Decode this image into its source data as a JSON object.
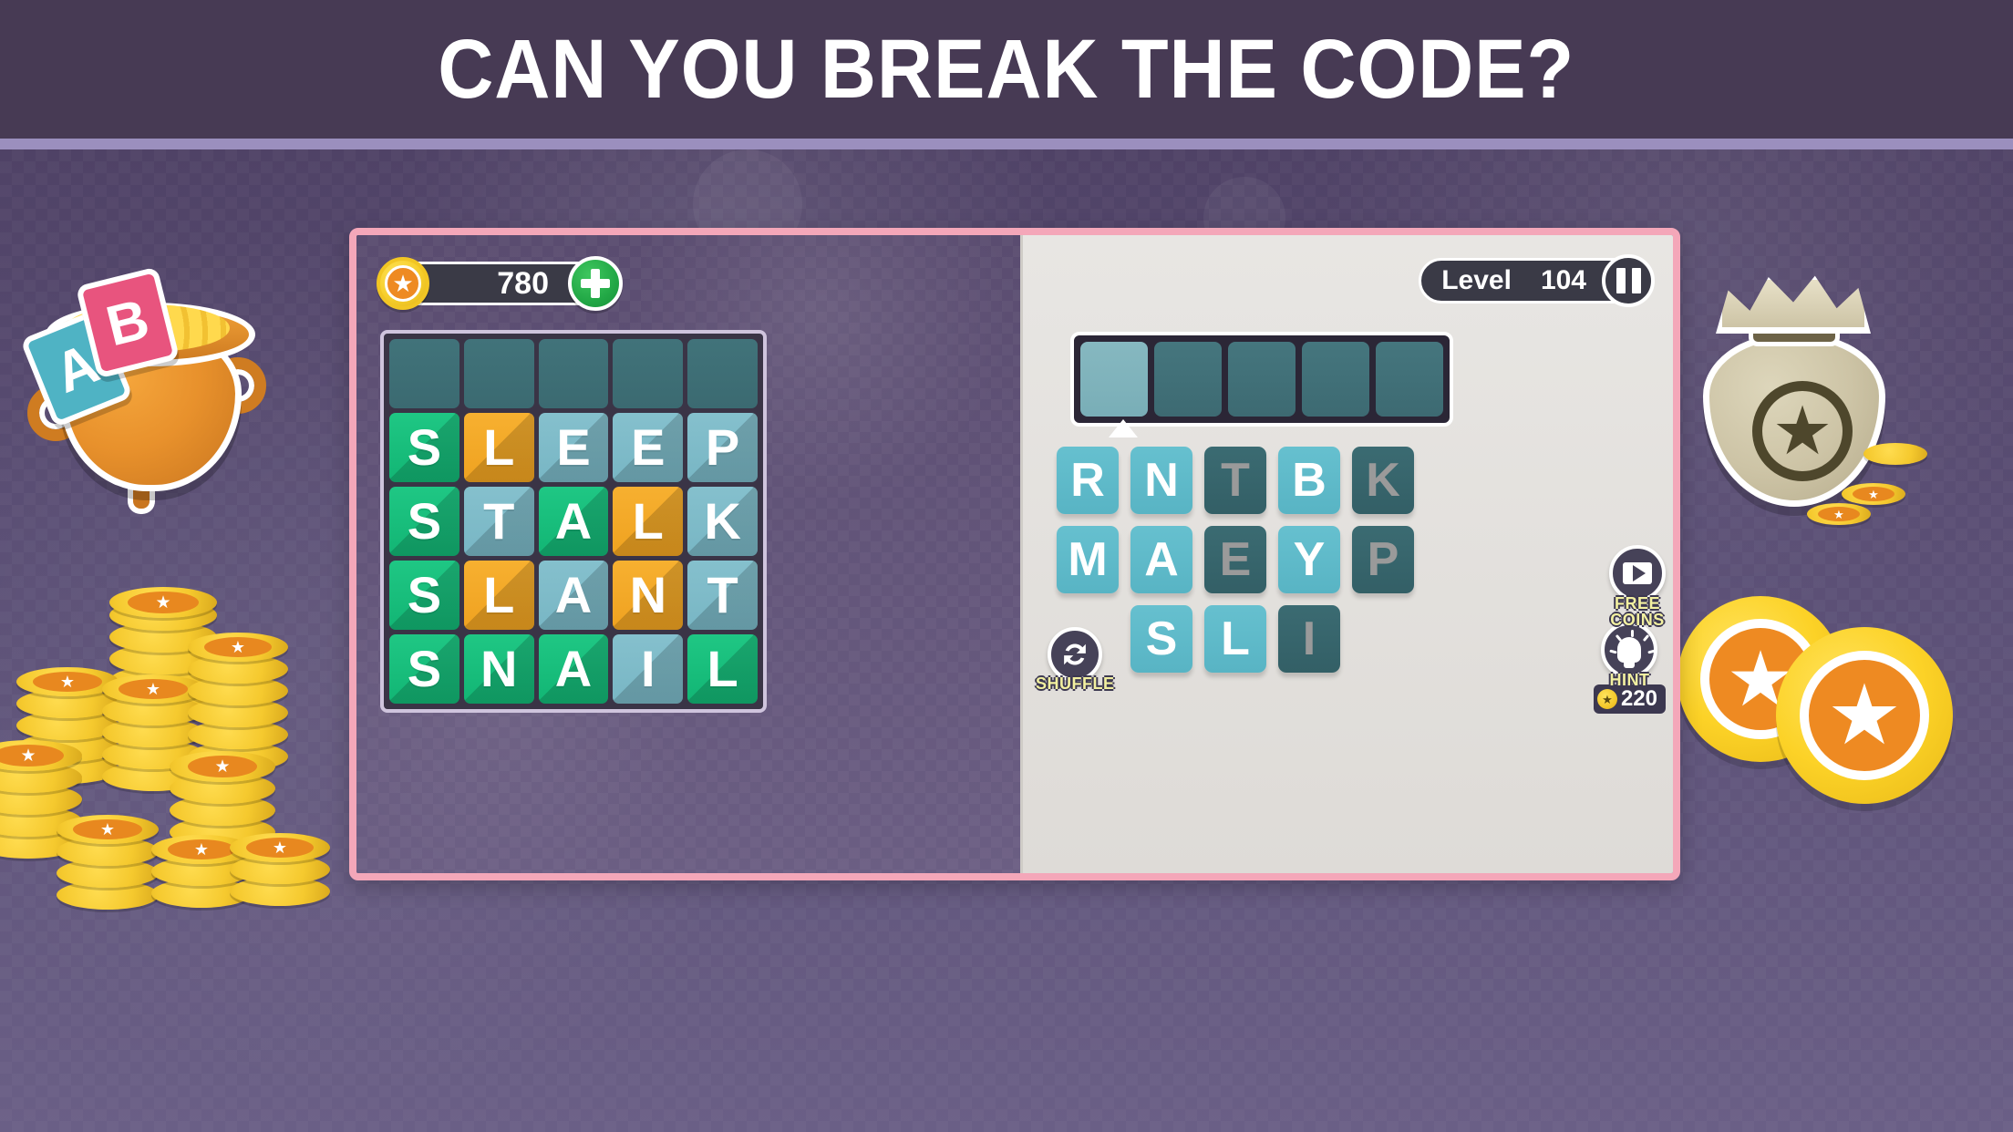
{
  "banner": {
    "title": "CAN YOU BREAK THE CODE?"
  },
  "hud": {
    "coins": "780",
    "coin_icon": "star-coin-icon",
    "add_label": "+",
    "level_label": "Level",
    "level_value": "104",
    "pause_icon": "pause-icon"
  },
  "word_grid": {
    "rows": [
      {
        "cells": [
          {
            "letter": "",
            "color": "empty"
          },
          {
            "letter": "",
            "color": "empty"
          },
          {
            "letter": "",
            "color": "empty"
          },
          {
            "letter": "",
            "color": "empty"
          },
          {
            "letter": "",
            "color": "empty"
          }
        ]
      },
      {
        "word": "SLEEP",
        "cells": [
          {
            "letter": "S",
            "color": "c-green"
          },
          {
            "letter": "L",
            "color": "c-orange"
          },
          {
            "letter": "E",
            "color": "c-blue"
          },
          {
            "letter": "E",
            "color": "c-blue"
          },
          {
            "letter": "P",
            "color": "c-blue"
          }
        ]
      },
      {
        "word": "STALK",
        "cells": [
          {
            "letter": "S",
            "color": "c-green"
          },
          {
            "letter": "T",
            "color": "c-blue"
          },
          {
            "letter": "A",
            "color": "c-green"
          },
          {
            "letter": "L",
            "color": "c-orange"
          },
          {
            "letter": "K",
            "color": "c-blue"
          }
        ]
      },
      {
        "word": "SLANT",
        "cells": [
          {
            "letter": "S",
            "color": "c-green"
          },
          {
            "letter": "L",
            "color": "c-orange"
          },
          {
            "letter": "A",
            "color": "c-blue"
          },
          {
            "letter": "N",
            "color": "c-orange"
          },
          {
            "letter": "T",
            "color": "c-blue"
          }
        ]
      },
      {
        "word": "SNAIL",
        "cells": [
          {
            "letter": "S",
            "color": "c-green"
          },
          {
            "letter": "N",
            "color": "c-green"
          },
          {
            "letter": "A",
            "color": "c-green"
          },
          {
            "letter": "I",
            "color": "c-blue"
          },
          {
            "letter": "L",
            "color": "c-green"
          }
        ]
      }
    ]
  },
  "answer_slots": [
    {
      "state": "active"
    },
    {
      "state": "empty"
    },
    {
      "state": "empty"
    },
    {
      "state": "empty"
    },
    {
      "state": "empty"
    }
  ],
  "letter_tray": {
    "rows": [
      [
        {
          "letter": "R",
          "state": "active"
        },
        {
          "letter": "N",
          "state": "active"
        },
        {
          "letter": "T",
          "state": "used"
        },
        {
          "letter": "B",
          "state": "active"
        },
        {
          "letter": "K",
          "state": "used"
        }
      ],
      [
        {
          "letter": "M",
          "state": "active"
        },
        {
          "letter": "A",
          "state": "active"
        },
        {
          "letter": "E",
          "state": "used"
        },
        {
          "letter": "Y",
          "state": "active"
        },
        {
          "letter": "P",
          "state": "used"
        }
      ],
      [
        {
          "letter": "S",
          "state": "active"
        },
        {
          "letter": "L",
          "state": "active"
        },
        {
          "letter": "I",
          "state": "used"
        }
      ]
    ]
  },
  "actions": {
    "shuffle_label": "SHUFFLE",
    "shuffle_icon": "refresh-icon",
    "free_coins_label_line1": "FREE",
    "free_coins_label_line2": "COINS",
    "free_coins_icon": "video-play-icon",
    "hint_label": "HINT",
    "hint_icon": "lightbulb-icon",
    "hint_cost": "220",
    "hint_cost_icon": "star-coin-icon"
  },
  "decorations": {
    "pot_tile_a": "A",
    "pot_tile_b": "B",
    "coin_star_glyph": "★",
    "bag_star_glyph": "★"
  },
  "colors": {
    "banner_bg": "#473a54",
    "banner_underline": "#9b8fbe",
    "panel_border": "#f4a7b9",
    "left_panel_bg": "#5f5278",
    "right_panel_bg": "#e3e1dd",
    "tile_green": "#17bd79",
    "tile_orange": "#f2a824",
    "tile_blue": "#7dbac8",
    "tile_empty": "#3f6f77",
    "tray_active": "#5db9c8",
    "tray_used": "#37656c",
    "hud_dark": "#3a3a46",
    "accent_green": "#22a846",
    "label_yellow": "#f2f0a0"
  }
}
